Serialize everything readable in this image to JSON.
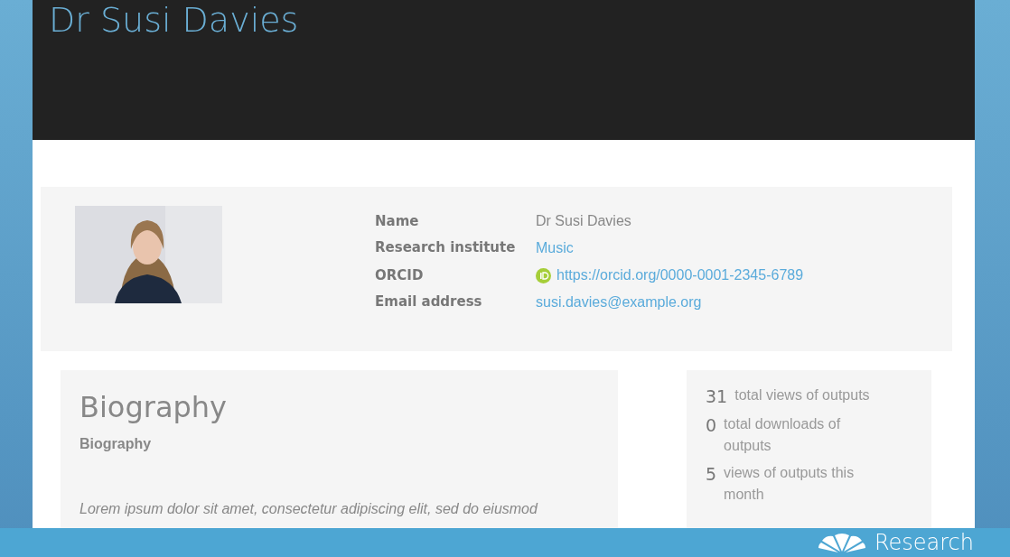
{
  "header": {
    "title": "Dr Susi Davies"
  },
  "profile": {
    "fields": [
      {
        "label": "Name",
        "value": "Dr Susi Davies",
        "kind": "text"
      },
      {
        "label": "Research institute",
        "value": "Music",
        "kind": "link"
      },
      {
        "label": "ORCID",
        "value": "https://orcid.org/0000-0001-2345-6789",
        "kind": "orcid"
      },
      {
        "label": "Email address",
        "value": "susi.davies@example.org",
        "kind": "link"
      }
    ]
  },
  "biography": {
    "heading": "Biography",
    "subheading": "Biography",
    "text": "Lorem ipsum dolor sit amet, consectetur adipiscing elit, sed do eiusmod"
  },
  "stats": [
    {
      "count": "31",
      "label": "total views of outputs"
    },
    {
      "count": "0",
      "label": "total downloads of outputs"
    },
    {
      "count": "5",
      "label": "views of outputs this month"
    }
  ],
  "footer": {
    "brand": "Research"
  }
}
